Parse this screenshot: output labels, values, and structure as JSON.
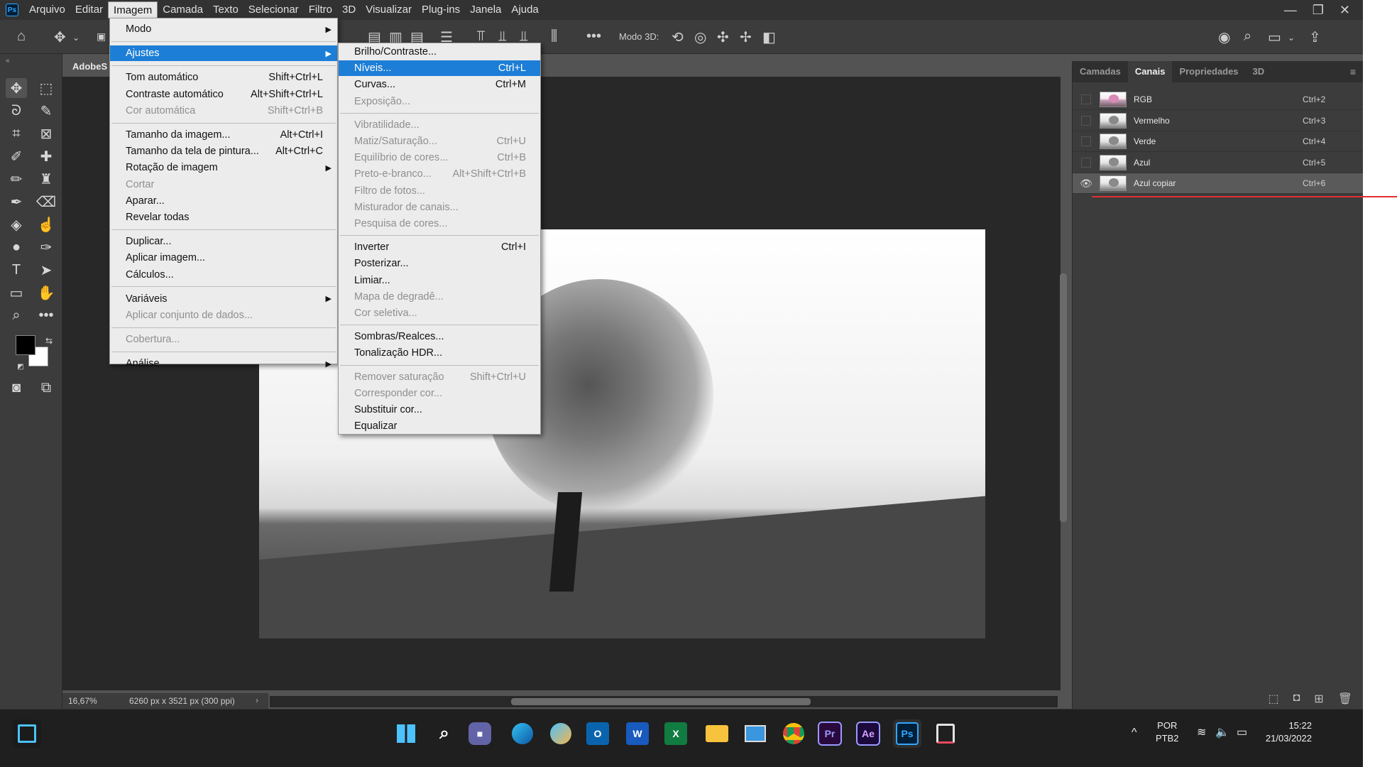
{
  "app": {
    "logo": "Ps"
  },
  "menubar": {
    "items": [
      "Arquivo",
      "Editar",
      "Imagem",
      "Camada",
      "Texto",
      "Selecionar",
      "Filtro",
      "3D",
      "Visualizar",
      "Plug-ins",
      "Janela",
      "Ajuda"
    ],
    "active": "Imagem"
  },
  "window_controls": {
    "minimize": "—",
    "restore": "❐",
    "close": "✕"
  },
  "optionsbar": {
    "mode3d_label": "Modo 3D:"
  },
  "document": {
    "tab_title": "AdobeS"
  },
  "imagem_menu": {
    "groups": [
      [
        {
          "label": "Modo",
          "shortcut": "",
          "submenu": true,
          "disabled": false
        }
      ],
      [
        {
          "label": "Ajustes",
          "shortcut": "",
          "submenu": true,
          "disabled": false,
          "highlighted": true
        }
      ],
      [
        {
          "label": "Tom automático",
          "shortcut": "Shift+Ctrl+L",
          "disabled": false
        },
        {
          "label": "Contraste automático",
          "shortcut": "Alt+Shift+Ctrl+L",
          "disabled": false
        },
        {
          "label": "Cor automática",
          "shortcut": "Shift+Ctrl+B",
          "disabled": true
        }
      ],
      [
        {
          "label": "Tamanho da imagem...",
          "shortcut": "Alt+Ctrl+I",
          "disabled": false
        },
        {
          "label": "Tamanho da tela de pintura...",
          "shortcut": "Alt+Ctrl+C",
          "disabled": false
        },
        {
          "label": "Rotação de imagem",
          "shortcut": "",
          "submenu": true,
          "disabled": false
        },
        {
          "label": "Cortar",
          "shortcut": "",
          "disabled": true
        },
        {
          "label": "Aparar...",
          "shortcut": "",
          "disabled": false
        },
        {
          "label": "Revelar todas",
          "shortcut": "",
          "disabled": false
        }
      ],
      [
        {
          "label": "Duplicar...",
          "shortcut": "",
          "disabled": false
        },
        {
          "label": "Aplicar imagem...",
          "shortcut": "",
          "disabled": false
        },
        {
          "label": "Cálculos...",
          "shortcut": "",
          "disabled": false
        }
      ],
      [
        {
          "label": "Variáveis",
          "shortcut": "",
          "submenu": true,
          "disabled": false
        },
        {
          "label": "Aplicar conjunto de dados...",
          "shortcut": "",
          "disabled": true
        }
      ],
      [
        {
          "label": "Cobertura...",
          "shortcut": "",
          "disabled": true
        }
      ],
      [
        {
          "label": "Análise",
          "shortcut": "",
          "submenu": true,
          "disabled": false
        }
      ]
    ]
  },
  "ajustes_menu": {
    "groups": [
      [
        {
          "label": "Brilho/Contraste...",
          "shortcut": "",
          "disabled": false
        },
        {
          "label": "Níveis...",
          "shortcut": "Ctrl+L",
          "disabled": false,
          "highlighted": true
        },
        {
          "label": "Curvas...",
          "shortcut": "Ctrl+M",
          "disabled": false
        },
        {
          "label": "Exposição...",
          "shortcut": "",
          "disabled": true
        }
      ],
      [
        {
          "label": "Vibratilidade...",
          "shortcut": "",
          "disabled": true
        },
        {
          "label": "Matiz/Saturação...",
          "shortcut": "Ctrl+U",
          "disabled": true
        },
        {
          "label": "Equilíbrio de cores...",
          "shortcut": "Ctrl+B",
          "disabled": true
        },
        {
          "label": "Preto-e-branco...",
          "shortcut": "Alt+Shift+Ctrl+B",
          "disabled": true
        },
        {
          "label": "Filtro de fotos...",
          "shortcut": "",
          "disabled": true
        },
        {
          "label": "Misturador de canais...",
          "shortcut": "",
          "disabled": true
        },
        {
          "label": "Pesquisa de cores...",
          "shortcut": "",
          "disabled": true
        }
      ],
      [
        {
          "label": "Inverter",
          "shortcut": "Ctrl+I",
          "disabled": false
        },
        {
          "label": "Posterizar...",
          "shortcut": "",
          "disabled": false
        },
        {
          "label": "Limiar...",
          "shortcut": "",
          "disabled": false
        },
        {
          "label": "Mapa de degradê...",
          "shortcut": "",
          "disabled": true
        },
        {
          "label": "Cor seletiva...",
          "shortcut": "",
          "disabled": true
        }
      ],
      [
        {
          "label": "Sombras/Realces...",
          "shortcut": "",
          "disabled": false
        },
        {
          "label": "Tonalização HDR...",
          "shortcut": "",
          "disabled": false
        }
      ],
      [
        {
          "label": "Remover saturação",
          "shortcut": "Shift+Ctrl+U",
          "disabled": true
        },
        {
          "label": "Corresponder cor...",
          "shortcut": "",
          "disabled": true
        },
        {
          "label": "Substituir cor...",
          "shortcut": "",
          "disabled": false
        },
        {
          "label": "Equalizar",
          "shortcut": "",
          "disabled": false
        }
      ]
    ]
  },
  "panel": {
    "tabs": [
      "Camadas",
      "Canais",
      "Propriedades",
      "3D"
    ],
    "active_tab": "Canais",
    "channels": [
      {
        "name": "RGB",
        "shortcut": "Ctrl+2",
        "visible": false,
        "selected": false
      },
      {
        "name": "Vermelho",
        "shortcut": "Ctrl+3",
        "visible": false,
        "selected": false
      },
      {
        "name": "Verde",
        "shortcut": "Ctrl+4",
        "visible": false,
        "selected": false
      },
      {
        "name": "Azul",
        "shortcut": "Ctrl+5",
        "visible": false,
        "selected": false
      },
      {
        "name": "Azul copiar",
        "shortcut": "Ctrl+6",
        "visible": true,
        "selected": true
      }
    ]
  },
  "status": {
    "zoom": "16,67%",
    "doc_info": "6260 px x 3521 px (300 ppi)"
  },
  "taskbar": {
    "apps": [
      "start-icon",
      "search-icon",
      "teams-icon",
      "edge-icon",
      "photos-icon",
      "outlook-icon",
      "word-icon",
      "excel-icon",
      "explorer-icon",
      "control-panel-icon",
      "chrome-icon",
      "premiere-icon",
      "after-effects-icon",
      "photoshop-icon",
      "snipping-icon"
    ],
    "app_labels": {
      "premiere": "Pr",
      "after_effects": "Ae",
      "photoshop": "Ps",
      "word": "W",
      "excel": "X",
      "outlook": "O"
    },
    "lang_top": "POR",
    "lang_bottom": "PTB2",
    "time": "15:22",
    "date": "21/03/2022"
  },
  "colors": {
    "accent": "#1c7ed6",
    "annotation_line": "#e03030",
    "app_bg": "#535353"
  }
}
